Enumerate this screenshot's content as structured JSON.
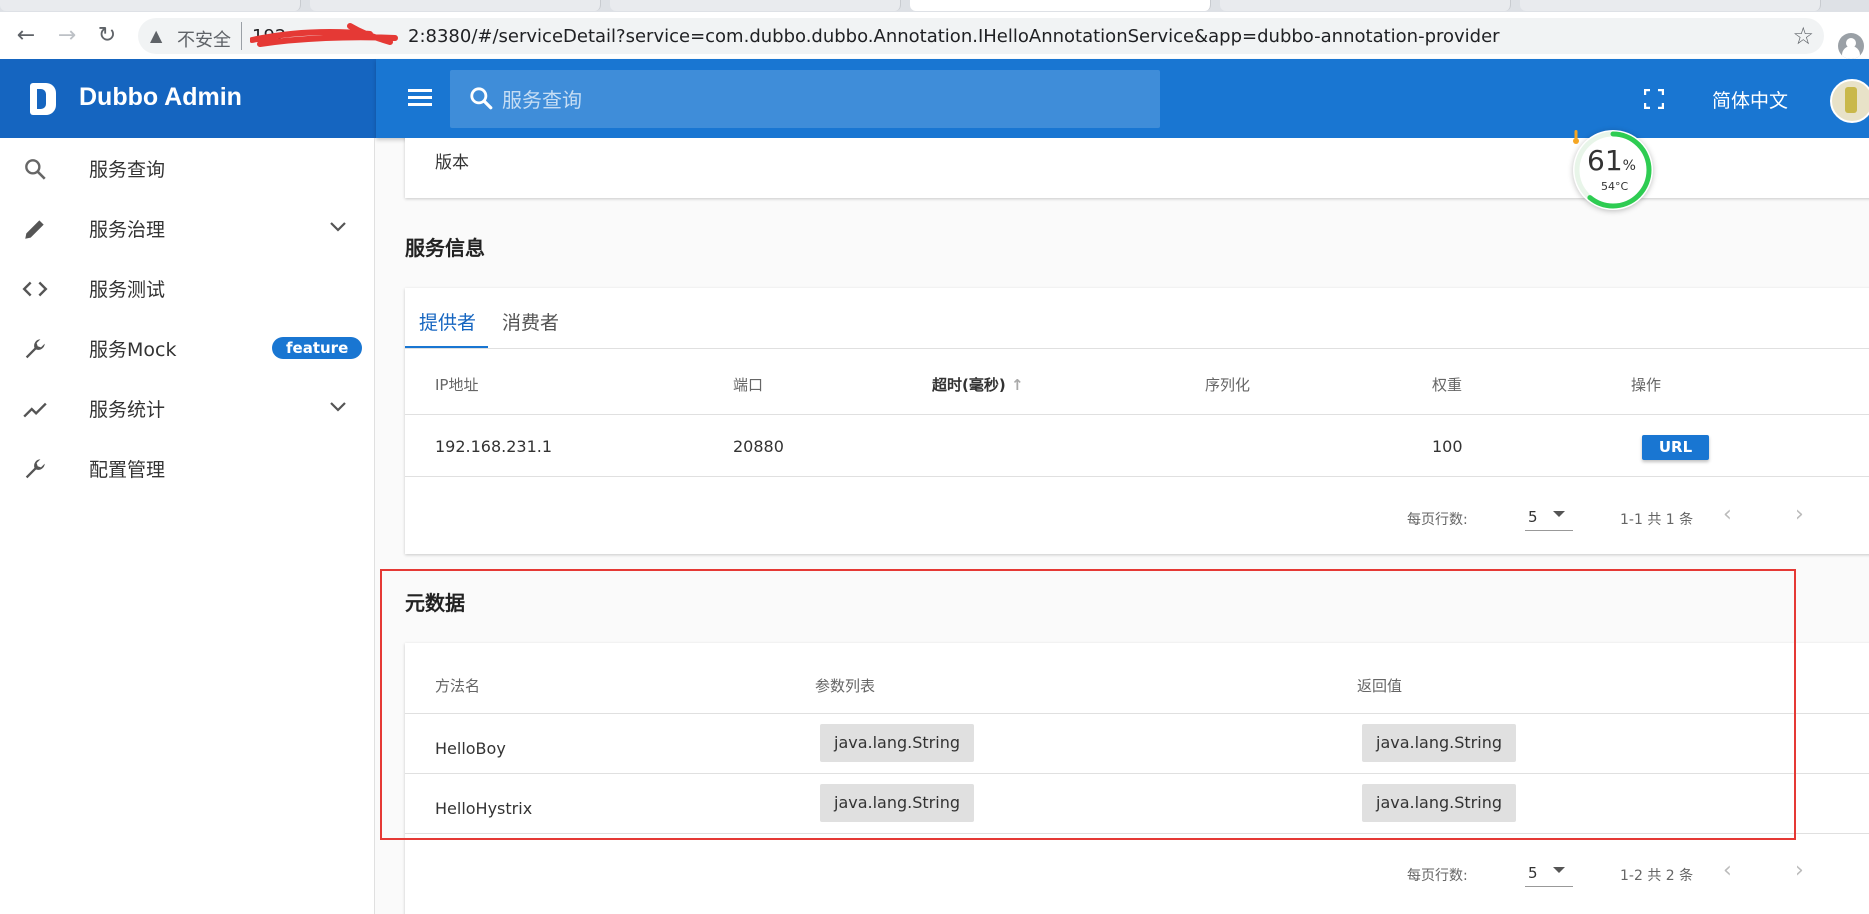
{
  "browser": {
    "insecure_label": "不安全",
    "host_visible": "192",
    "url": "2:8380/#/serviceDetail?service=com.dubbo.dubbo.Annotation.IHelloAnnotationService&app=dubbo-annotation-provider"
  },
  "app": {
    "brand": "Dubbo Admin",
    "search_placeholder": "服务查询",
    "language": "简体中文"
  },
  "sidebar": {
    "items": [
      {
        "label": "服务查询",
        "icon": "search-icon"
      },
      {
        "label": "服务治理",
        "icon": "pencil-icon",
        "expandable": true
      },
      {
        "label": "服务测试",
        "icon": "code-icon"
      },
      {
        "label": "服务Mock",
        "icon": "wrench-icon",
        "badge": "feature"
      },
      {
        "label": "服务统计",
        "icon": "trending-icon",
        "expandable": true
      },
      {
        "label": "配置管理",
        "icon": "wrench-icon"
      }
    ]
  },
  "version": {
    "label": "版本"
  },
  "service_info": {
    "title": "服务信息",
    "tabs": [
      "提供者",
      "消费者"
    ],
    "active_tab": "提供者",
    "columns": [
      "IP地址",
      "端口",
      "超时(毫秒)",
      "序列化",
      "权重",
      "操作"
    ],
    "sort_indicator": "↑",
    "rows": [
      {
        "ip": "192.168.231.1",
        "port": "20880",
        "timeout": "",
        "serialization": "",
        "weight": "100",
        "action": "URL"
      }
    ],
    "pagination": {
      "rows_per_page_label": "每页行数:",
      "rows_per_page": "5",
      "range": "1-1 共 1 条"
    }
  },
  "metadata": {
    "title": "元数据",
    "columns": [
      "方法名",
      "参数列表",
      "返回值"
    ],
    "rows": [
      {
        "method": "HelloBoy",
        "params": "java.lang.String",
        "return": "java.lang.String"
      },
      {
        "method": "HelloHystrix",
        "params": "java.lang.String",
        "return": "java.lang.String"
      }
    ],
    "pagination": {
      "rows_per_page_label": "每页行数:",
      "rows_per_page": "5",
      "range": "1-2 共 2 条"
    }
  },
  "widget": {
    "cpu_percent": "61",
    "percent_sign": "%",
    "temperature": "54°C"
  },
  "colors": {
    "primary": "#1976d2",
    "primary_dark": "#1565c0",
    "highlight": "#e53935"
  }
}
